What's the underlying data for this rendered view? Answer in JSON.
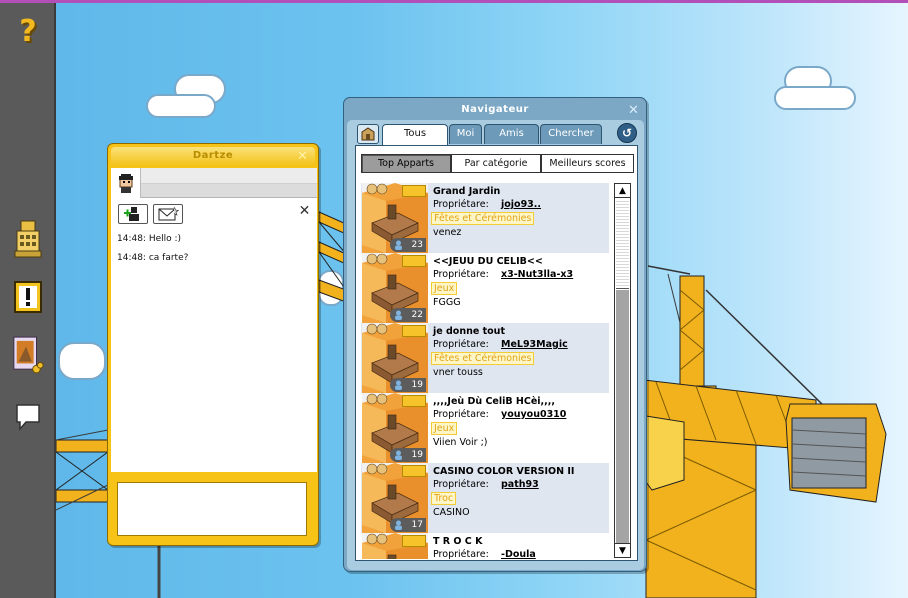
{
  "chat": {
    "title": "Dartze",
    "messages": [
      {
        "time": "14:48:",
        "text": "Hello :)"
      },
      {
        "time": "14:48:",
        "text": "ca farte?"
      }
    ]
  },
  "navigator": {
    "title": "Navigateur",
    "tabs": [
      "Tous",
      "Moi",
      "Amis",
      "Chercher"
    ],
    "active_tab": "Tous",
    "subtabs": [
      "Top Apparts",
      "Par catégorie",
      "Meilleurs scores"
    ],
    "active_subtab": "Top Apparts",
    "owner_label": "Propriétare:",
    "rooms": [
      {
        "name": "Grand Jardin",
        "owner": "jojo93..",
        "category": "Fêtes et Cérémonies",
        "description": "venez",
        "users": "23"
      },
      {
        "name": "<<JEUU DU CELIB<<",
        "owner": "x3-Nut3lla-x3",
        "category": "Jeux",
        "description": "FGGG",
        "users": "22"
      },
      {
        "name": "je donne tout",
        "owner": "MeL93Magic",
        "category": "Fêtes et Cérémonies",
        "description": "vner touss",
        "users": "19"
      },
      {
        "name": ",,,,Jeù Dù CeliB HCèi,,,,",
        "owner": "youyou0310",
        "category": "Jeux",
        "description": "Viien Voir ;)",
        "users": "19"
      },
      {
        "name": "CASINO COLOR VERSION II",
        "owner": "path93",
        "category": "Troc",
        "description": "CASINO",
        "users": "17"
      },
      {
        "name": "T R O C K",
        "owner": "-Doula",
        "category": "",
        "description": "",
        "users": ""
      }
    ]
  },
  "colors": {
    "chat_frame": "#f7c316",
    "navigator_frame": "#7ca8c6",
    "category_text": "#e2a418",
    "sky": "#6dc3ef"
  }
}
